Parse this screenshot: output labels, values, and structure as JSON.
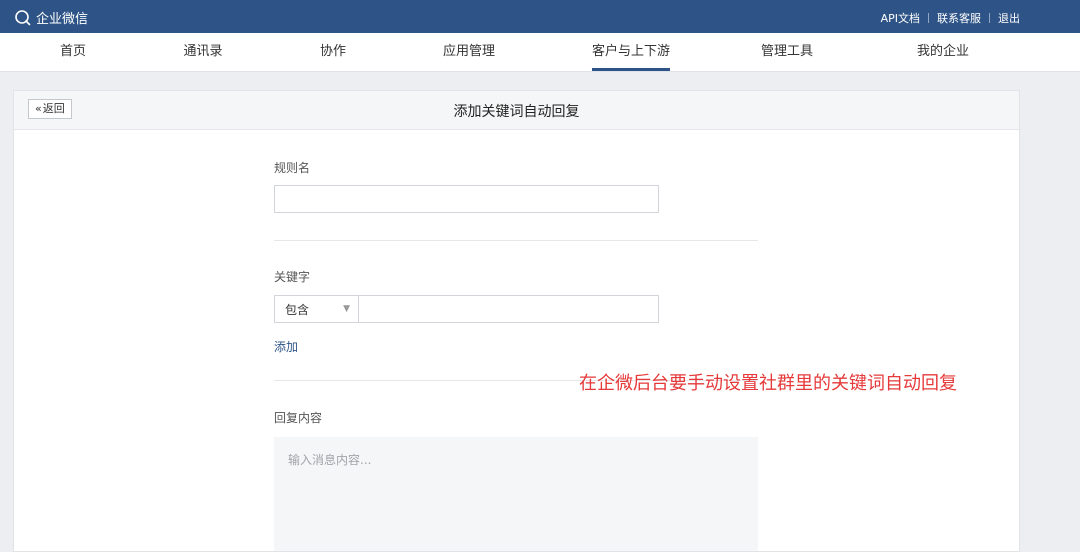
{
  "topbar": {
    "app_name": "企业微信",
    "links": [
      "API文档",
      "联系客服",
      "退出"
    ]
  },
  "nav": {
    "items": [
      "首页",
      "通讯录",
      "协作",
      "应用管理",
      "客户与上下游",
      "管理工具",
      "我的企业"
    ],
    "active": "客户与上下游"
  },
  "card": {
    "back_label": "返回",
    "title": "添加关键词自动回复"
  },
  "form": {
    "rule_name_label": "规则名",
    "rule_name_value": "",
    "keyword_label": "关键字",
    "match_select_value": "包含",
    "keyword_value": "",
    "add_label": "添加",
    "reply_label": "回复内容",
    "reply_placeholder": "输入消息内容..."
  },
  "annotation_text": "在企微后台要手动设置社群里的关键词自动回复",
  "colors": {
    "topbar": "#2e5487",
    "annotation": "#e6393a",
    "link": "#2e5487"
  }
}
